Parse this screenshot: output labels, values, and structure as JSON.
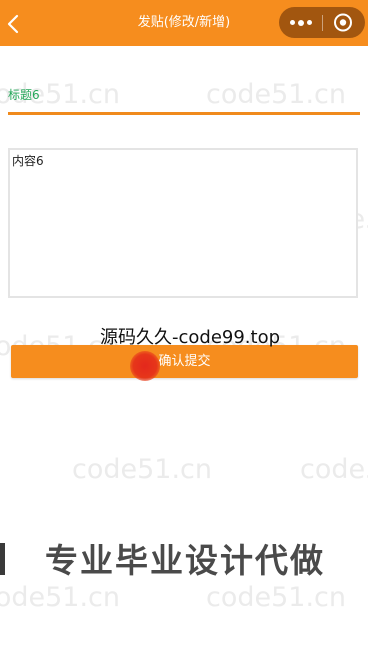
{
  "navbar": {
    "title": "发贴(修改/新增)",
    "back_icon": "chevron-left-icon",
    "more_icon": "more-dots-icon",
    "close_icon": "target-circle-icon",
    "color": "#f68d1e"
  },
  "form": {
    "title_value": "标题6",
    "content_value": "内容6",
    "submit_label": "确认提交"
  },
  "overlays": {
    "source_text": "源码久久-code99.top",
    "banner_text": "专业毕业设计代做",
    "watermark": "code51.cn"
  },
  "colors": {
    "accent": "#f68d1e",
    "title_text": "#26a85a",
    "touch_indicator": "#e4281c"
  }
}
